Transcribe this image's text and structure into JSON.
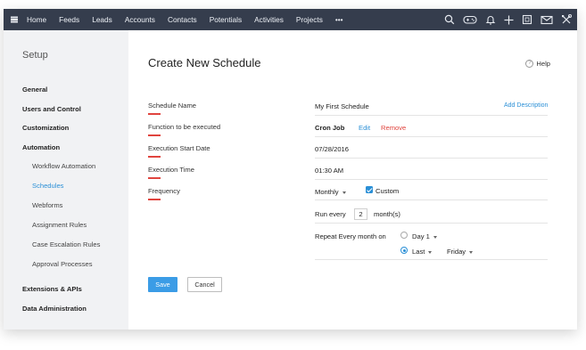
{
  "topnav": {
    "items": [
      "Home",
      "Feeds",
      "Leads",
      "Accounts",
      "Contacts",
      "Potentials",
      "Activities",
      "Projects",
      "•••"
    ]
  },
  "sidebar": {
    "title": "Setup",
    "items": [
      {
        "label": "General",
        "level": "top"
      },
      {
        "label": "Users and Control",
        "level": "top"
      },
      {
        "label": "Customization",
        "level": "top"
      },
      {
        "label": "Automation",
        "level": "top"
      },
      {
        "label": "Workflow Automation",
        "level": "sub"
      },
      {
        "label": "Schedules",
        "level": "sub",
        "active": true
      },
      {
        "label": "Webforms",
        "level": "sub"
      },
      {
        "label": "Assignment Rules",
        "level": "sub"
      },
      {
        "label": "Case Escalation Rules",
        "level": "sub"
      },
      {
        "label": "Approval Processes",
        "level": "sub"
      },
      {
        "label": "Extensions & APIs",
        "level": "top"
      },
      {
        "label": "Data Administration",
        "level": "top"
      }
    ]
  },
  "main": {
    "title": "Create New Schedule",
    "help": "Help",
    "form": {
      "schedule_name_label": "Schedule Name",
      "schedule_name_value": "My First Schedule",
      "add_description": "Add Description",
      "function_label": "Function to be executed",
      "function_value": "Cron Job",
      "edit": "Edit",
      "remove": "Remove",
      "start_date_label": "Execution Start Date",
      "start_date_value": "07/28/2016",
      "time_label": "Execution Time",
      "time_value": "01:30 AM",
      "frequency_label": "Frequency",
      "frequency_value": "Monthly",
      "custom_label": "Custom",
      "custom_checked": true,
      "run_every_label": "Run every",
      "run_every_value": "2",
      "run_every_unit": "month(s)",
      "repeat_label": "Repeat Every month on",
      "day_option": "Day 1",
      "day_option_selected": false,
      "last_option": "Last",
      "last_option_selected": true,
      "weekday_value": "Friday"
    },
    "save": "Save",
    "cancel": "Cancel"
  },
  "colors": {
    "nav_bg": "#353d4d",
    "accent": "#3b9ce6",
    "link": "#2a8fd6",
    "required_marker": "#e0443e",
    "sidebar_bg": "#f1f2f4"
  }
}
